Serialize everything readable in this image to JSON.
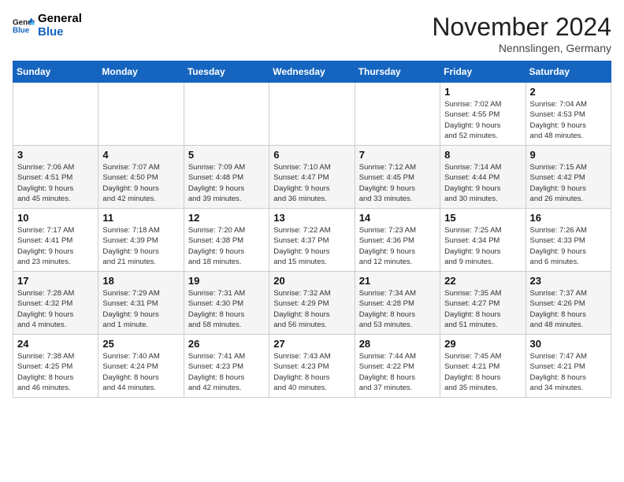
{
  "header": {
    "logo_general": "General",
    "logo_blue": "Blue",
    "title": "November 2024",
    "location": "Nennslingen, Germany"
  },
  "days_of_week": [
    "Sunday",
    "Monday",
    "Tuesday",
    "Wednesday",
    "Thursday",
    "Friday",
    "Saturday"
  ],
  "weeks": [
    [
      {
        "day": "",
        "info": ""
      },
      {
        "day": "",
        "info": ""
      },
      {
        "day": "",
        "info": ""
      },
      {
        "day": "",
        "info": ""
      },
      {
        "day": "",
        "info": ""
      },
      {
        "day": "1",
        "info": "Sunrise: 7:02 AM\nSunset: 4:55 PM\nDaylight: 9 hours\nand 52 minutes."
      },
      {
        "day": "2",
        "info": "Sunrise: 7:04 AM\nSunset: 4:53 PM\nDaylight: 9 hours\nand 48 minutes."
      }
    ],
    [
      {
        "day": "3",
        "info": "Sunrise: 7:06 AM\nSunset: 4:51 PM\nDaylight: 9 hours\nand 45 minutes."
      },
      {
        "day": "4",
        "info": "Sunrise: 7:07 AM\nSunset: 4:50 PM\nDaylight: 9 hours\nand 42 minutes."
      },
      {
        "day": "5",
        "info": "Sunrise: 7:09 AM\nSunset: 4:48 PM\nDaylight: 9 hours\nand 39 minutes."
      },
      {
        "day": "6",
        "info": "Sunrise: 7:10 AM\nSunset: 4:47 PM\nDaylight: 9 hours\nand 36 minutes."
      },
      {
        "day": "7",
        "info": "Sunrise: 7:12 AM\nSunset: 4:45 PM\nDaylight: 9 hours\nand 33 minutes."
      },
      {
        "day": "8",
        "info": "Sunrise: 7:14 AM\nSunset: 4:44 PM\nDaylight: 9 hours\nand 30 minutes."
      },
      {
        "day": "9",
        "info": "Sunrise: 7:15 AM\nSunset: 4:42 PM\nDaylight: 9 hours\nand 26 minutes."
      }
    ],
    [
      {
        "day": "10",
        "info": "Sunrise: 7:17 AM\nSunset: 4:41 PM\nDaylight: 9 hours\nand 23 minutes."
      },
      {
        "day": "11",
        "info": "Sunrise: 7:18 AM\nSunset: 4:39 PM\nDaylight: 9 hours\nand 21 minutes."
      },
      {
        "day": "12",
        "info": "Sunrise: 7:20 AM\nSunset: 4:38 PM\nDaylight: 9 hours\nand 18 minutes."
      },
      {
        "day": "13",
        "info": "Sunrise: 7:22 AM\nSunset: 4:37 PM\nDaylight: 9 hours\nand 15 minutes."
      },
      {
        "day": "14",
        "info": "Sunrise: 7:23 AM\nSunset: 4:36 PM\nDaylight: 9 hours\nand 12 minutes."
      },
      {
        "day": "15",
        "info": "Sunrise: 7:25 AM\nSunset: 4:34 PM\nDaylight: 9 hours\nand 9 minutes."
      },
      {
        "day": "16",
        "info": "Sunrise: 7:26 AM\nSunset: 4:33 PM\nDaylight: 9 hours\nand 6 minutes."
      }
    ],
    [
      {
        "day": "17",
        "info": "Sunrise: 7:28 AM\nSunset: 4:32 PM\nDaylight: 9 hours\nand 4 minutes."
      },
      {
        "day": "18",
        "info": "Sunrise: 7:29 AM\nSunset: 4:31 PM\nDaylight: 9 hours\nand 1 minute."
      },
      {
        "day": "19",
        "info": "Sunrise: 7:31 AM\nSunset: 4:30 PM\nDaylight: 8 hours\nand 58 minutes."
      },
      {
        "day": "20",
        "info": "Sunrise: 7:32 AM\nSunset: 4:29 PM\nDaylight: 8 hours\nand 56 minutes."
      },
      {
        "day": "21",
        "info": "Sunrise: 7:34 AM\nSunset: 4:28 PM\nDaylight: 8 hours\nand 53 minutes."
      },
      {
        "day": "22",
        "info": "Sunrise: 7:35 AM\nSunset: 4:27 PM\nDaylight: 8 hours\nand 51 minutes."
      },
      {
        "day": "23",
        "info": "Sunrise: 7:37 AM\nSunset: 4:26 PM\nDaylight: 8 hours\nand 48 minutes."
      }
    ],
    [
      {
        "day": "24",
        "info": "Sunrise: 7:38 AM\nSunset: 4:25 PM\nDaylight: 8 hours\nand 46 minutes."
      },
      {
        "day": "25",
        "info": "Sunrise: 7:40 AM\nSunset: 4:24 PM\nDaylight: 8 hours\nand 44 minutes."
      },
      {
        "day": "26",
        "info": "Sunrise: 7:41 AM\nSunset: 4:23 PM\nDaylight: 8 hours\nand 42 minutes."
      },
      {
        "day": "27",
        "info": "Sunrise: 7:43 AM\nSunset: 4:23 PM\nDaylight: 8 hours\nand 40 minutes."
      },
      {
        "day": "28",
        "info": "Sunrise: 7:44 AM\nSunset: 4:22 PM\nDaylight: 8 hours\nand 37 minutes."
      },
      {
        "day": "29",
        "info": "Sunrise: 7:45 AM\nSunset: 4:21 PM\nDaylight: 8 hours\nand 35 minutes."
      },
      {
        "day": "30",
        "info": "Sunrise: 7:47 AM\nSunset: 4:21 PM\nDaylight: 8 hours\nand 34 minutes."
      }
    ]
  ]
}
